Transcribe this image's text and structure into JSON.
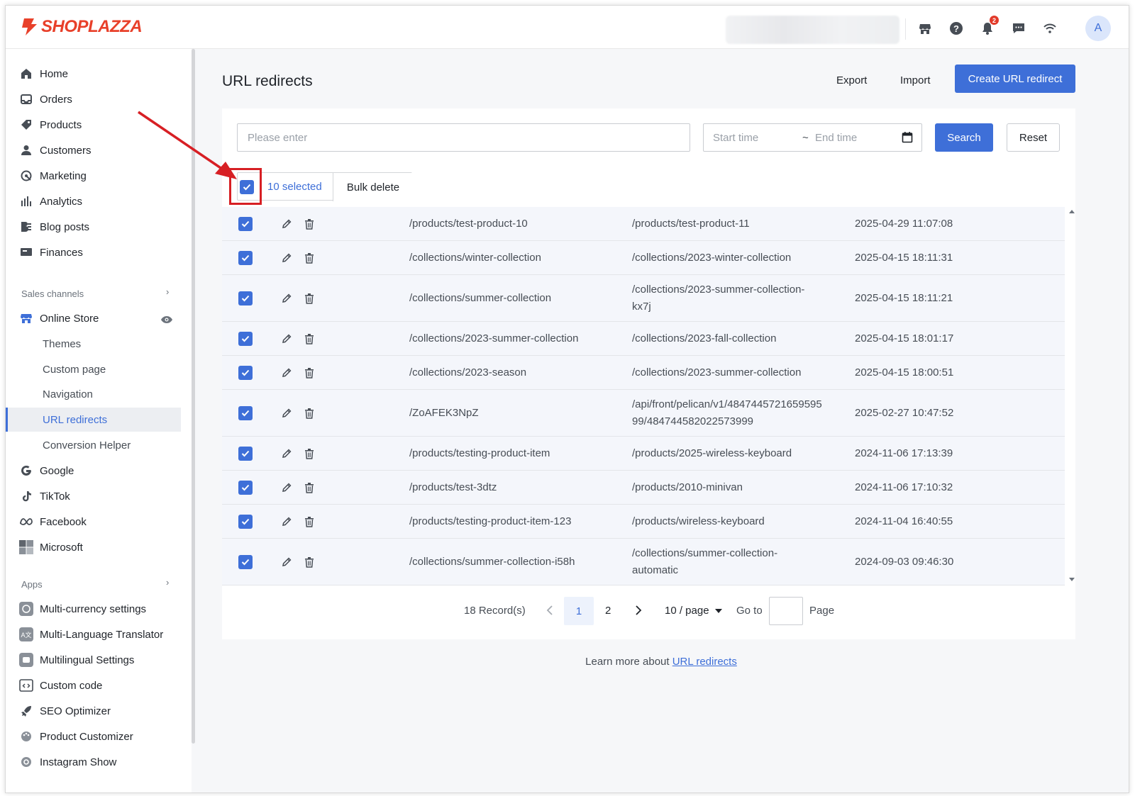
{
  "brand": {
    "logo_text": "SHOPLAZZA",
    "accent": "#3e6fd8",
    "logo_color": "#e8402a"
  },
  "topbar": {
    "icons": [
      "store-icon",
      "help-icon",
      "bell-icon",
      "chat-icon",
      "wifi-icon"
    ],
    "notification_count": "2",
    "avatar_letter": "A"
  },
  "sidebar": {
    "main_items": [
      {
        "label": "Home",
        "icon": "home-icon"
      },
      {
        "label": "Orders",
        "icon": "orders-icon"
      },
      {
        "label": "Products",
        "icon": "tag-icon"
      },
      {
        "label": "Customers",
        "icon": "person-icon"
      },
      {
        "label": "Marketing",
        "icon": "marketing-icon"
      },
      {
        "label": "Analytics",
        "icon": "bar-chart-icon"
      },
      {
        "label": "Blog posts",
        "icon": "blog-icon"
      },
      {
        "label": "Finances",
        "icon": "finance-icon"
      }
    ],
    "sales_channels_label": "Sales channels",
    "online_store_label": "Online Store",
    "online_store_sub": [
      "Themes",
      "Custom page",
      "Navigation",
      "URL redirects",
      "Conversion Helper"
    ],
    "active_sub": "URL redirects",
    "channels": [
      "Google",
      "TikTok",
      "Facebook",
      "Microsoft"
    ],
    "apps_label": "Apps",
    "apps": [
      "Multi-currency settings",
      "Multi-Language Translator",
      "Multilingual Settings",
      "Custom code",
      "SEO Optimizer",
      "Product Customizer",
      "Instagram Show"
    ]
  },
  "page": {
    "title": "URL redirects",
    "export_label": "Export",
    "import_label": "Import",
    "create_label": "Create URL redirect"
  },
  "filters": {
    "search_placeholder": "Please enter",
    "start_placeholder": "Start time",
    "tilde": "~",
    "end_placeholder": "End time",
    "search_label": "Search",
    "reset_label": "Reset"
  },
  "bulk": {
    "selected_text": "10 selected",
    "bulk_delete_label": "Bulk delete"
  },
  "table": {
    "rows": [
      {
        "from": "/products/test-product-10",
        "to": [
          "/products/test-product-11"
        ],
        "time": "2025-04-29 11:07:08"
      },
      {
        "from": "/collections/winter-collection",
        "to": [
          "/collections/2023-winter-collection"
        ],
        "time": "2025-04-15 18:11:31"
      },
      {
        "from": "/collections/summer-collection",
        "to": [
          "/collections/2023-summer-collection-",
          "kx7j"
        ],
        "time": "2025-04-15 18:11:21"
      },
      {
        "from": "/collections/2023-summer-collection",
        "to": [
          "/collections/2023-fall-collection"
        ],
        "time": "2025-04-15 18:01:17"
      },
      {
        "from": "/collections/2023-season",
        "to": [
          "/collections/2023-summer-collection"
        ],
        "time": "2025-04-15 18:00:51"
      },
      {
        "from": "/ZoAFEK3NpZ",
        "to": [
          "/api/front/pelican/v1/4847445721659595",
          "99/484744582022573999"
        ],
        "time": "2025-02-27 10:47:52"
      },
      {
        "from": "/products/testing-product-item",
        "to": [
          "/products/2025-wireless-keyboard"
        ],
        "time": "2024-11-06 17:13:39"
      },
      {
        "from": "/products/test-3dtz",
        "to": [
          "/products/2010-minivan"
        ],
        "time": "2024-11-06 17:10:32"
      },
      {
        "from": "/products/testing-product-item-123",
        "to": [
          "/products/wireless-keyboard"
        ],
        "time": "2024-11-04 16:40:55"
      },
      {
        "from": "/collections/summer-collection-i58h",
        "to": [
          "/collections/summer-collection-",
          "automatic"
        ],
        "time": "2024-09-03 09:46:30"
      }
    ]
  },
  "pagination": {
    "records": "18 Record(s)",
    "pages": [
      "1",
      "2"
    ],
    "current_page": "1",
    "per_page": "10 / page",
    "goto_label": "Go to",
    "page_label": "Page"
  },
  "footer": {
    "learn_text": "Learn more about ",
    "learn_link": "URL redirects"
  }
}
